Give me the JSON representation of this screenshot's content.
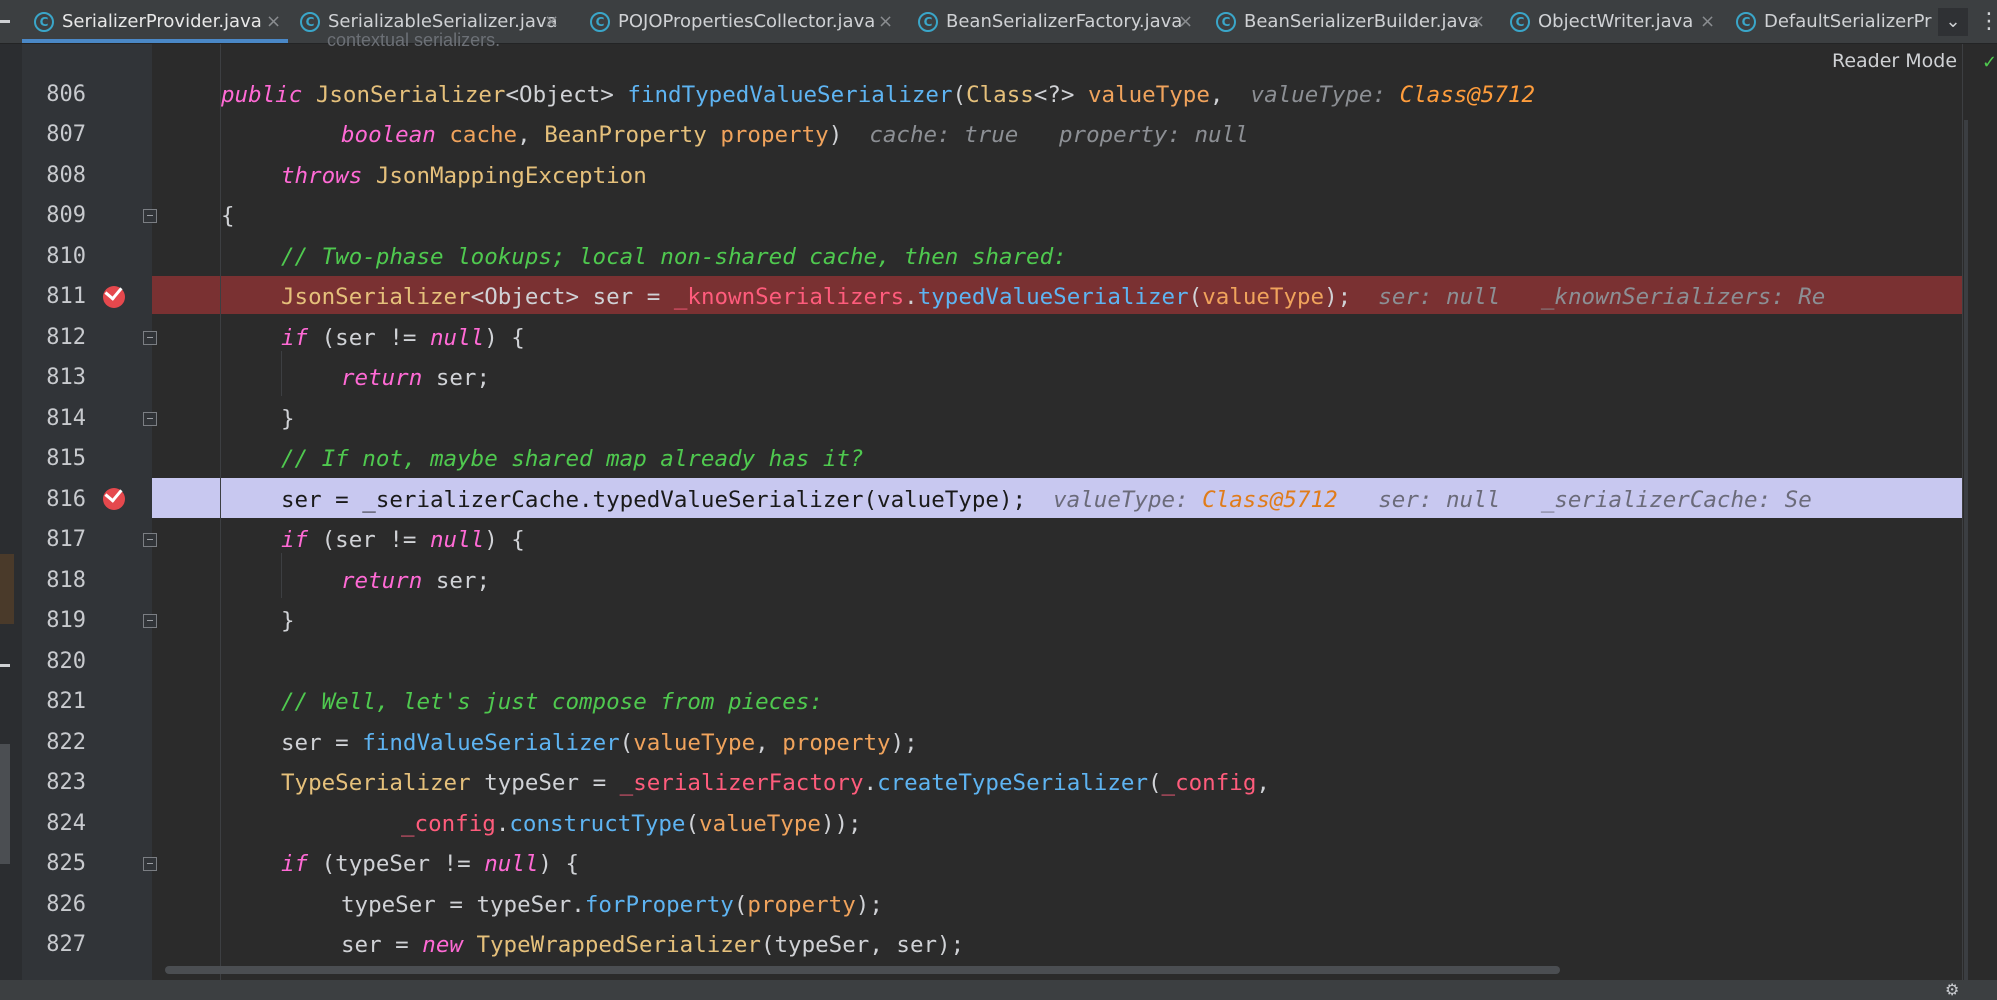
{
  "tabs": [
    {
      "label": "SerializerProvider.java",
      "close": "×",
      "icon": "class-icon",
      "active": true
    },
    {
      "label": "SerializableSerializer.java",
      "close": "×",
      "icon": "class-icon"
    },
    {
      "label": "POJOPropertiesCollector.java",
      "close": "×",
      "icon": "class-icon"
    },
    {
      "label": "BeanSerializerFactory.java",
      "close": "×",
      "icon": "class-icon"
    },
    {
      "label": "BeanSerializerBuilder.java",
      "close": "×",
      "icon": "class-icon"
    },
    {
      "label": "ObjectWriter.java",
      "close": "×",
      "icon": "class-icon"
    },
    {
      "label": "DefaultSerializerPro",
      "icon": "class-icon"
    }
  ],
  "tab_more_icon": "chevron-down-icon",
  "tab_menu_icon": "kebab-icon",
  "reader_mode": "Reader Mode",
  "doc_fragment": "contextual serializers.",
  "lines": [
    {
      "no": "806",
      "text": "public JsonSerializer<Object> findTypedValueSerializer(Class<?> valueType,  valueType: Class@5712"
    },
    {
      "no": "807",
      "text": "boolean cache, BeanProperty property)  cache: true   property: null"
    },
    {
      "no": "808",
      "text": "throws JsonMappingException"
    },
    {
      "no": "809",
      "text": "{"
    },
    {
      "no": "810",
      "text": "// Two-phase lookups; local non-shared cache, then shared:"
    },
    {
      "no": "811",
      "text": "JsonSerializer<Object> ser = _knownSerializers.typedValueSerializer(valueType);  ser: null   _knownSerializers: Re",
      "breakpoint": true
    },
    {
      "no": "812",
      "text": "if (ser != null) {"
    },
    {
      "no": "813",
      "text": "return ser;"
    },
    {
      "no": "814",
      "text": "}"
    },
    {
      "no": "815",
      "text": "// If not, maybe shared map already has it?"
    },
    {
      "no": "816",
      "text": "ser = _serializerCache.typedValueSerializer(valueType);  valueType: Class@5712   ser: null   _serializerCache: Se",
      "breakpoint": true,
      "current": true
    },
    {
      "no": "817",
      "text": "if (ser != null) {"
    },
    {
      "no": "818",
      "text": "return ser;"
    },
    {
      "no": "819",
      "text": "}"
    },
    {
      "no": "820",
      "text": ""
    },
    {
      "no": "821",
      "text": "// Well, let's just compose from pieces:"
    },
    {
      "no": "822",
      "text": "ser = findValueSerializer(valueType, property);"
    },
    {
      "no": "823",
      "text": "TypeSerializer typeSer = _serializerFactory.createTypeSerializer(_config,"
    },
    {
      "no": "824",
      "text": "_config.constructType(valueType));"
    },
    {
      "no": "825",
      "text": "if (typeSer != null) {"
    },
    {
      "no": "826",
      "text": "typeSer = typeSer.forProperty(property);"
    },
    {
      "no": "827",
      "text": "ser = new TypeWrappedSerializer(typeSer, ser);"
    }
  ],
  "tokens": {
    "public": "public",
    "JsonSerializer": "JsonSerializer",
    "lt_object_gt": "<Object>",
    "findTypedValueSerializer": "findTypedValueSerializer",
    "Class": "Class",
    "wildcard": "<?>",
    "valueType": "valueType",
    "comma": ",",
    "hint_valueType_label": "valueType:",
    "hint_Class5712": "Class@5712",
    "boolean": "boolean",
    "cache": "cache",
    "BeanProperty": "BeanProperty",
    "property": "property",
    "close_paren": ")",
    "hint_cache": "cache: true",
    "hint_property": "property: null",
    "throws": "throws",
    "JsonMappingException": "JsonMappingException",
    "open_brace": "{",
    "close_brace": "}",
    "comment_810": "// Two-phase lookups; local non-shared cache, then shared:",
    "ser_eq": "ser =",
    "_knownSerializers": "_knownSerializers",
    "dot": ".",
    "typedValueSerializer": "typedValueSerializer",
    "open_paren": "(",
    "close_semi": ");",
    "hint_ser_null": "ser: null",
    "hint_known": "_knownSerializers: Re",
    "if": "if",
    "ser_neq_null_open": "(ser != ",
    "null": "null",
    "paren_brace": ") {",
    "return": "return",
    "ser_semi": "ser;",
    "comment_815": "// If not, maybe shared map already has it?",
    "line_816_code": "ser = _serializerCache.typedValueSerializer(valueType);",
    "hint_serializerCache": "_serializerCache: Se",
    "comment_821": "// Well, let's just compose from pieces:",
    "findValueSerializer": "findValueSerializer",
    "TypeSerializer": "TypeSerializer",
    "typeSer_eq": "typeSer =",
    "_serializerFactory": "_serializerFactory",
    "createTypeSerializer": "createTypeSerializer",
    "_config": "_config",
    "constructType": "constructType",
    "typeSer_neq_open": "(typeSer != ",
    "typeSer_eq_typeSer": "typeSer = typeSer.",
    "forProperty": "forProperty",
    "new": "new",
    "TypeWrappedSerializer": "TypeWrappedSerializer",
    "args_typeSer_ser": "(typeSer, ser);",
    "comma_space": ", "
  }
}
